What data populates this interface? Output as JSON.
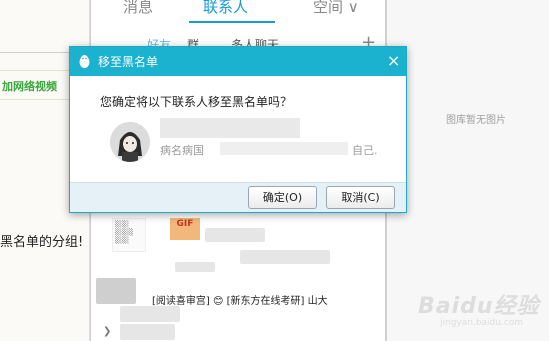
{
  "background": {
    "left_link": "加网络视频",
    "left_text": "黑名单的分组!",
    "right_no_image": "图库暂无图片",
    "watermark": "Baidu经验",
    "watermark_sub": "jingyan.baidu.com"
  },
  "qq_panel": {
    "tabs": [
      {
        "label": "消息"
      },
      {
        "label": "联系人"
      },
      {
        "label": "空间 ∨"
      }
    ],
    "subtabs": [
      {
        "label": "好友"
      },
      {
        "label": "群"
      },
      {
        "label": "多人聊天"
      }
    ],
    "add_icon": "plus-icon",
    "gif_badge": "GIF",
    "contact_row_text": "[阅读喜审宫] 😊 [新东方在线考研] 山大",
    "expand_icon": "chevron-right-icon"
  },
  "dialog": {
    "title": "移至黑名单",
    "close_label": "×",
    "question": "您确定将以下联系人移至黑名单吗？",
    "contact_subtext": "病名病国",
    "contact_subtext_tail": "自己.",
    "ok_label": "确定(O)",
    "cancel_label": "取消(C)",
    "accent_color": "#1ab2cf"
  }
}
